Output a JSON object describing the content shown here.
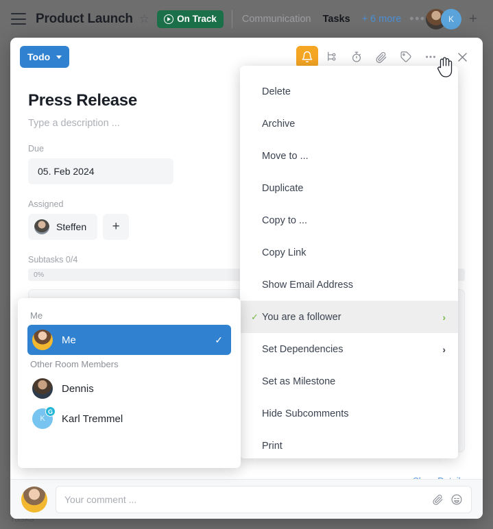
{
  "background_app": {
    "hamburger_icon": "menu-icon",
    "project_title": "Product Launch",
    "star_icon": "☆",
    "status_badge": "On Track",
    "status_color": "#1b7049",
    "tabs": [
      {
        "label": "Communication",
        "active": false
      },
      {
        "label": "Tasks",
        "active": true
      },
      {
        "label": "+ 6 more",
        "active": false
      }
    ],
    "tabs_overflow_icon": "•••",
    "avatar_k_initial": "K",
    "add_member_icon": "+",
    "bottom_label": "Tasks"
  },
  "modal": {
    "status_select": {
      "label": "Todo",
      "color": "#3081d0"
    },
    "toolbar_icons": [
      {
        "name": "bell-icon",
        "active": true,
        "color": "#f5a623"
      },
      {
        "name": "subtasks-icon",
        "active": false
      },
      {
        "name": "stopwatch-icon",
        "active": false
      },
      {
        "name": "attachment-icon",
        "active": false
      },
      {
        "name": "tag-icon",
        "active": false
      },
      {
        "name": "more-options-icon",
        "active": false
      }
    ],
    "close_icon": "close-icon",
    "title": "Press Release",
    "description_placeholder": "Type a description ...",
    "due": {
      "label": "Due",
      "value": "05. Feb 2024"
    },
    "assigned": {
      "label": "Assigned",
      "assignee": "Steffen",
      "add_icon": "+"
    },
    "subtasks": {
      "label": "Subtasks",
      "count": "0/4",
      "progress_text": "0%",
      "progress_percent": 0
    },
    "show_details": "Show Details",
    "comment": {
      "placeholder": "Your comment ...",
      "value": "",
      "attach_icon": "attachment-icon",
      "emoji_icon": "emoji-icon"
    }
  },
  "context_menu": {
    "items": [
      {
        "label": "Delete",
        "checked": false,
        "submenu": false,
        "selected": false
      },
      {
        "label": "Archive",
        "checked": false,
        "submenu": false,
        "selected": false
      },
      {
        "label": "Move to ...",
        "checked": false,
        "submenu": false,
        "selected": false
      },
      {
        "label": "Duplicate",
        "checked": false,
        "submenu": false,
        "selected": false
      },
      {
        "label": "Copy to ...",
        "checked": false,
        "submenu": false,
        "selected": false
      },
      {
        "label": "Copy Link",
        "checked": false,
        "submenu": false,
        "selected": false
      },
      {
        "label": "Show Email Address",
        "checked": false,
        "submenu": false,
        "selected": false
      },
      {
        "label": "You are a follower",
        "checked": true,
        "submenu": true,
        "selected": true
      },
      {
        "label": "Set Dependencies",
        "checked": false,
        "submenu": true,
        "selected": false
      },
      {
        "label": "Set as Milestone",
        "checked": false,
        "submenu": false,
        "selected": false
      },
      {
        "label": "Hide Subcomments",
        "checked": false,
        "submenu": false,
        "selected": false
      },
      {
        "label": "Print",
        "checked": false,
        "submenu": false,
        "selected": false
      }
    ],
    "check_glyph": "✓",
    "arrow_glyph": "›",
    "highlight_color": "#76b947"
  },
  "member_popup": {
    "sections": [
      {
        "title": "Me",
        "members": [
          {
            "name": "Me",
            "selected": true,
            "avatar": "photo",
            "badge": ""
          }
        ]
      },
      {
        "title": "Other Room Members",
        "members": [
          {
            "name": "Dennis",
            "selected": false,
            "avatar": "photo",
            "badge": ""
          },
          {
            "name": "Karl Tremmel",
            "selected": false,
            "avatar": "initial",
            "initial": "K",
            "badge": "G"
          }
        ]
      }
    ],
    "check_glyph": "✓",
    "selected_color": "#3081d0"
  },
  "cursor": {
    "type": "pointer-hand"
  }
}
